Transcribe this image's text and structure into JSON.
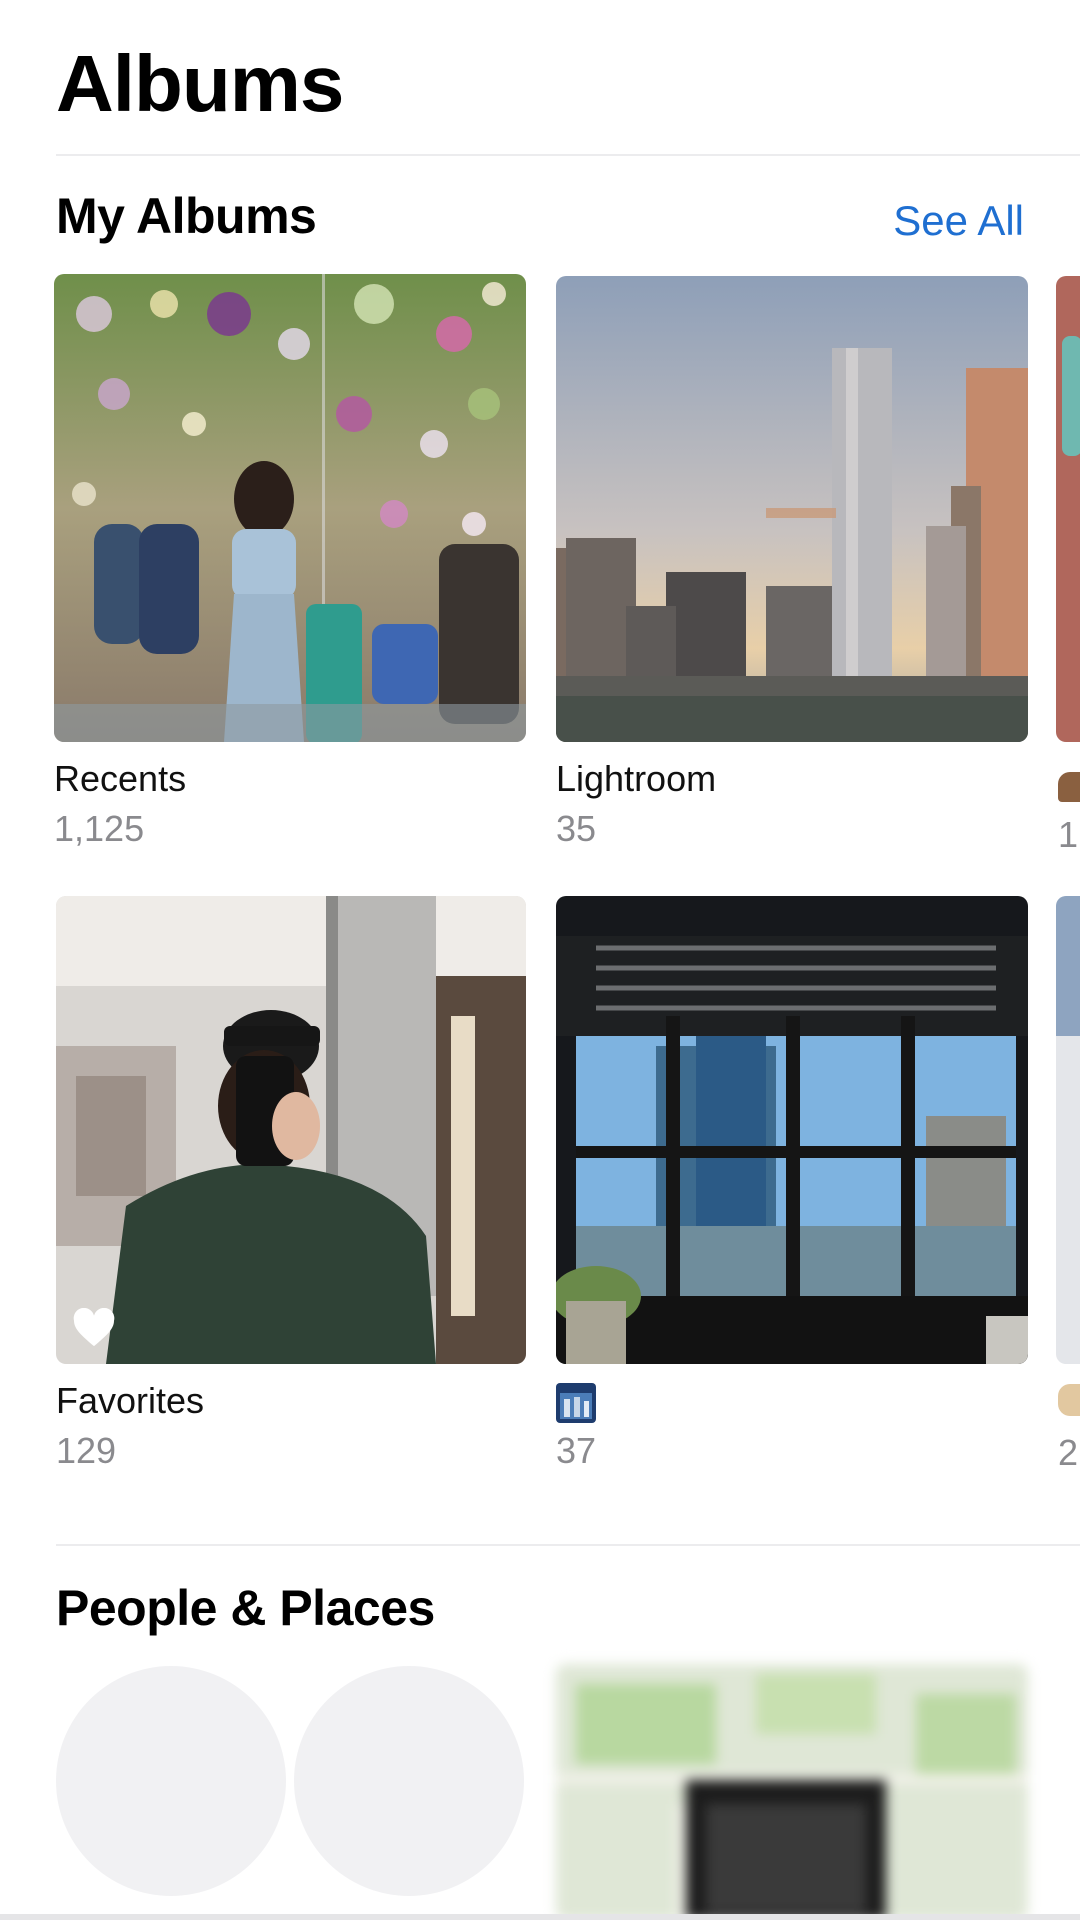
{
  "header": {
    "title": "Albums"
  },
  "my_albums": {
    "title": "My Albums",
    "see_all_label": "See All",
    "albums": [
      {
        "name": "Recents",
        "count": "1,125"
      },
      {
        "name": "Lightroom",
        "count": "35"
      },
      {
        "name": "Favorites",
        "count": "129"
      },
      {
        "name": "",
        "count": "37"
      }
    ],
    "peek_counts": [
      "1",
      "2"
    ]
  },
  "people_places": {
    "title": "People & Places"
  },
  "icons": {
    "favorite": "heart-icon",
    "album_name_thumbnail": "photo-thumbnail-icon"
  },
  "colors": {
    "accent": "#1f6fd1",
    "secondary_text": "#8a8a8e"
  }
}
